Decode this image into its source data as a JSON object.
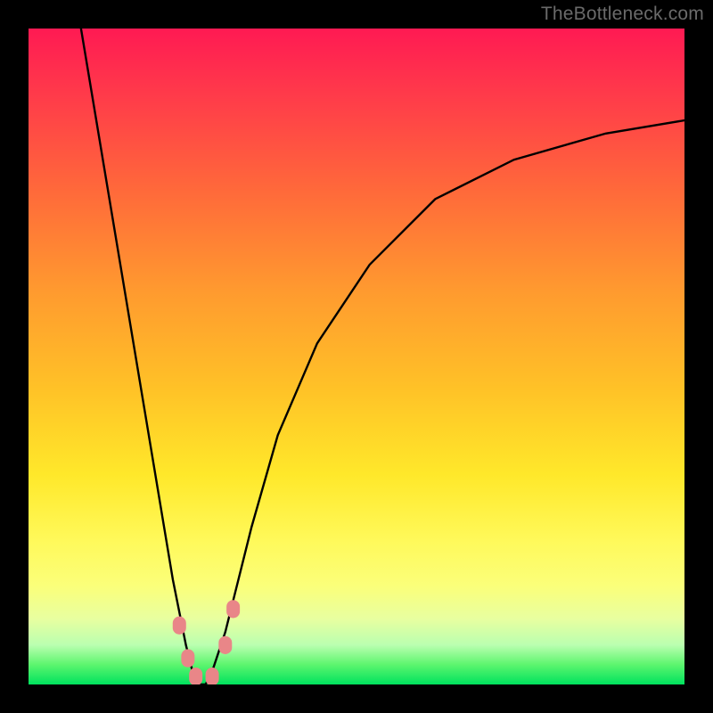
{
  "attribution": "TheBottleneck.com",
  "chart_data": {
    "type": "line",
    "title": "",
    "xlabel": "",
    "ylabel": "",
    "xlim": [
      0,
      100
    ],
    "ylim": [
      0,
      100
    ],
    "grid": false,
    "legend": false,
    "background_gradient": {
      "direction": "vertical",
      "stops": [
        {
          "pos": 0.0,
          "color": "#ff1a53"
        },
        {
          "pos": 0.25,
          "color": "#ff6a3a"
        },
        {
          "pos": 0.55,
          "color": "#ffc227"
        },
        {
          "pos": 0.78,
          "color": "#fff95a"
        },
        {
          "pos": 0.94,
          "color": "#baffb0"
        },
        {
          "pos": 1.0,
          "color": "#00e25e"
        }
      ]
    },
    "series": [
      {
        "name": "bottleneck-curve",
        "color": "#000000",
        "x": [
          8,
          10,
          12,
          14,
          16,
          18,
          20,
          22,
          24,
          25,
          26,
          27,
          28,
          30,
          32,
          34,
          38,
          44,
          52,
          62,
          74,
          88,
          100
        ],
        "values": [
          100,
          88,
          76,
          64,
          52,
          40,
          28,
          16,
          6,
          2,
          0,
          0,
          2,
          8,
          16,
          24,
          38,
          52,
          64,
          74,
          80,
          84,
          86
        ]
      }
    ],
    "markers": [
      {
        "name": "trough-marker-1",
        "x": 23.0,
        "y": 9.0,
        "color": "#e98688",
        "size": 15
      },
      {
        "name": "trough-marker-2",
        "x": 24.3,
        "y": 4.0,
        "color": "#e98688",
        "size": 15
      },
      {
        "name": "trough-marker-3",
        "x": 25.5,
        "y": 1.2,
        "color": "#e98688",
        "size": 15
      },
      {
        "name": "trough-marker-4",
        "x": 28.0,
        "y": 1.2,
        "color": "#e98688",
        "size": 15
      },
      {
        "name": "trough-marker-5",
        "x": 30.0,
        "y": 6.0,
        "color": "#e98688",
        "size": 15
      },
      {
        "name": "trough-marker-6",
        "x": 31.2,
        "y": 11.5,
        "color": "#e98688",
        "size": 15
      }
    ]
  }
}
